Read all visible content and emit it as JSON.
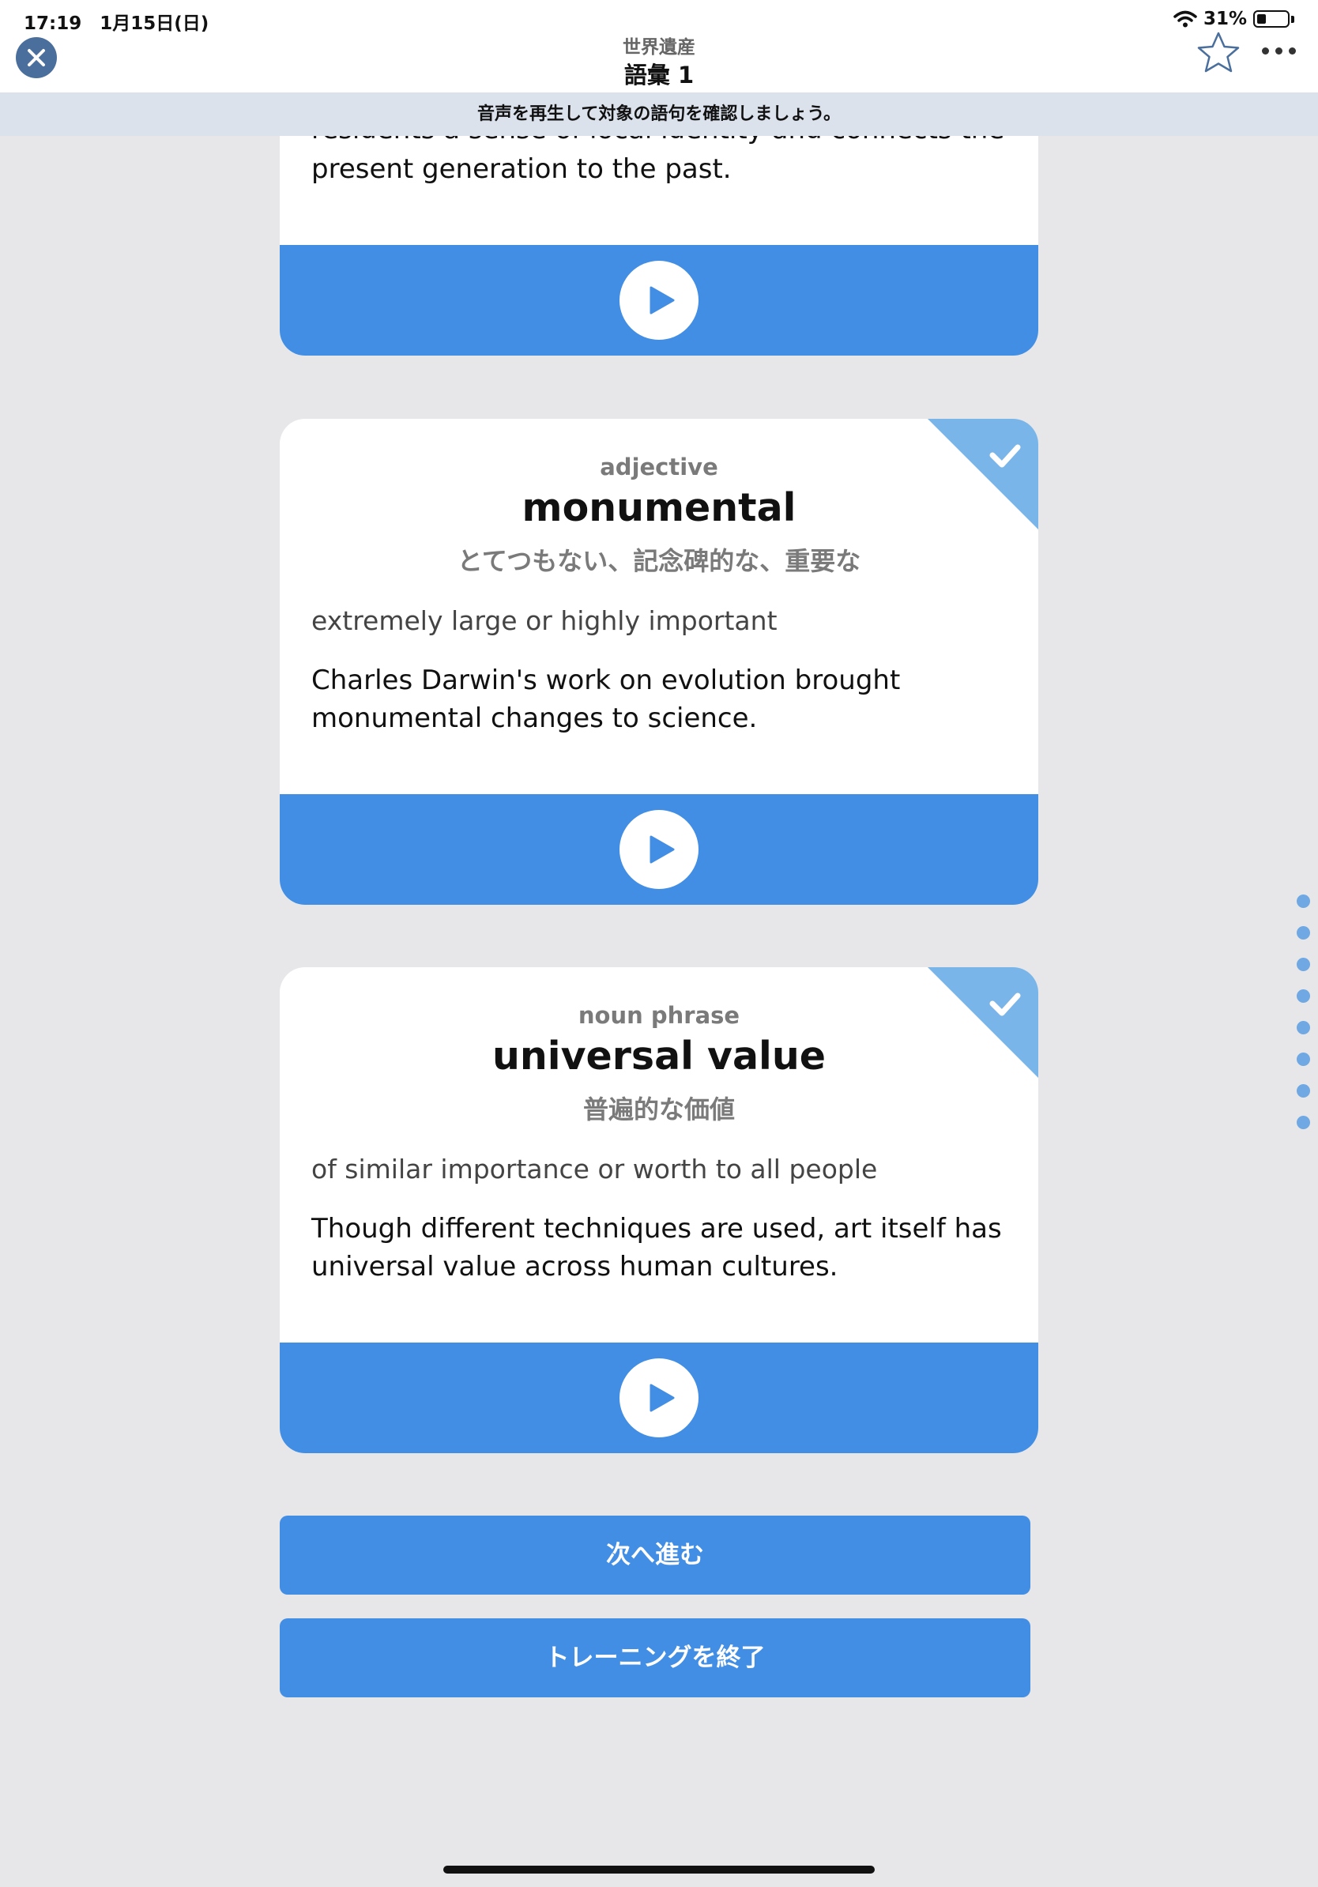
{
  "status_bar": {
    "time_date": "17:19　1月15日(日)",
    "battery": "31%"
  },
  "nav": {
    "subtitle": "世界遺産",
    "title": "語彙 1"
  },
  "banner": {
    "text": "音声を再生して対象の語句を確認しましょう。"
  },
  "cards": [
    {
      "partial_top_line": "residents a sense of local identity and connects the",
      "example_end": "present generation to the past."
    },
    {
      "pos": "adjective",
      "word": "monumental",
      "japanese": "とてつもない、記念碑的な、重要な",
      "definition": "extremely large or highly important",
      "example_line1": "Charles Darwin's work on evolution brought",
      "example_line2": "monumental changes to science.",
      "checked": true
    },
    {
      "pos": "noun phrase",
      "word": "universal value",
      "japanese": "普遍的な価値",
      "definition": "of similar importance or worth to all people",
      "example_line1": "Though different techniques are used, art itself has",
      "example_line2": "universal value across human cultures.",
      "checked": true
    }
  ],
  "buttons": {
    "next": "次へ進む",
    "finish": "トレーニングを終了"
  },
  "page_indicator_count": 8,
  "colors": {
    "accent_blue": "#418ee4",
    "check_corner": "#79b5e8",
    "close_button": "#4b6f9c",
    "banner_bg": "#dbe2ec",
    "page_bg": "#e7e7e9"
  },
  "icons": [
    "close-icon",
    "star-icon",
    "more-icon",
    "play-icon",
    "check-icon",
    "wifi-icon",
    "battery-icon"
  ]
}
